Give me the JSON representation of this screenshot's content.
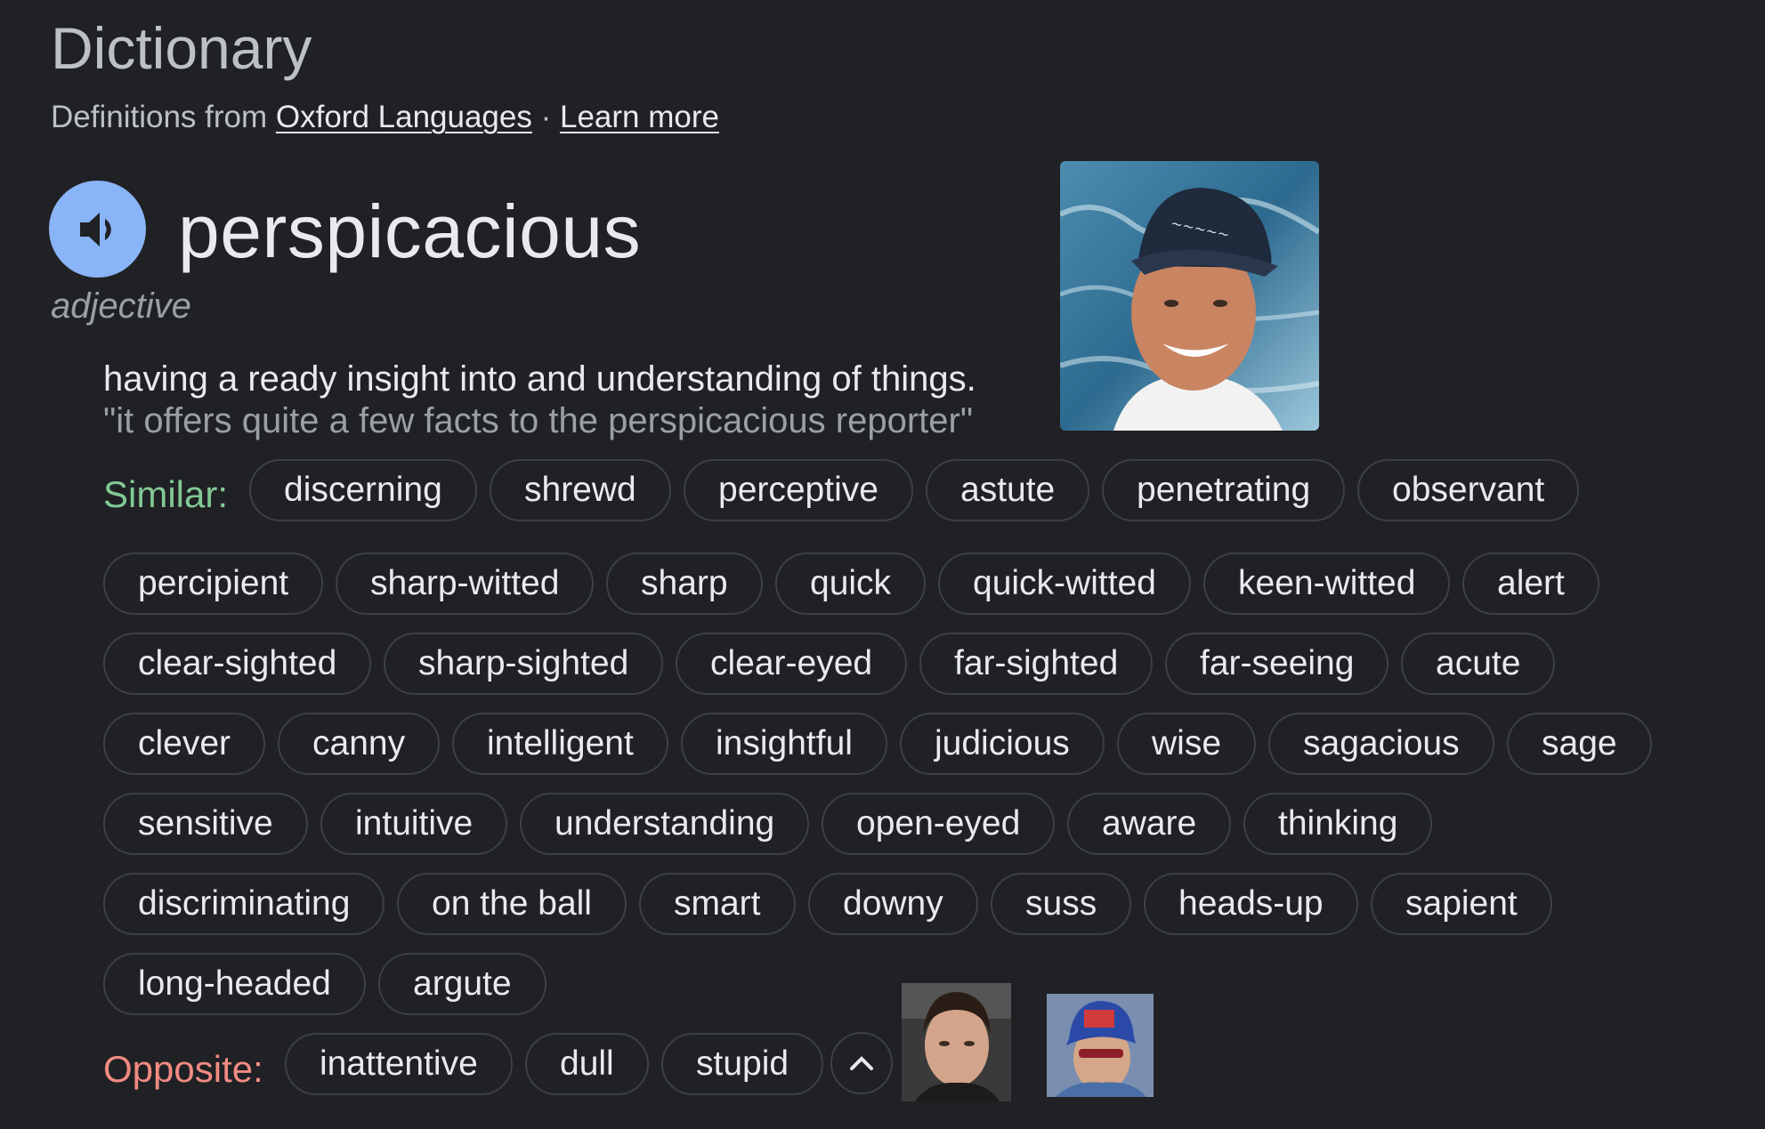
{
  "header": {
    "title": "Dictionary",
    "source_prefix": "Definitions from",
    "source_link": "Oxford Languages",
    "separator": "·",
    "learn_more": "Learn more"
  },
  "entry": {
    "word": "perspicacious",
    "part_of_speech": "adjective",
    "definition": "having a ready insight into and understanding of things.",
    "example": "\"it offers quite a few facts to the perspicacious reporter\"",
    "speaker_icon": "volume-speaker-icon"
  },
  "similar": {
    "label": "Similar:",
    "words": [
      "discerning",
      "shrewd",
      "perceptive",
      "astute",
      "penetrating",
      "observant",
      "percipient",
      "sharp-witted",
      "sharp",
      "quick",
      "quick-witted",
      "keen-witted",
      "alert",
      "clear-sighted",
      "sharp-sighted",
      "clear-eyed",
      "far-sighted",
      "far-seeing",
      "acute",
      "clever",
      "canny",
      "intelligent",
      "insightful",
      "judicious",
      "wise",
      "sagacious",
      "sage",
      "sensitive",
      "intuitive",
      "understanding",
      "open-eyed",
      "aware",
      "thinking",
      "discriminating",
      "on the ball",
      "smart",
      "downy",
      "suss",
      "heads-up",
      "sapient",
      "long-headed",
      "argute"
    ]
  },
  "opposite": {
    "label": "Opposite:",
    "words": [
      "inattentive",
      "dull",
      "stupid"
    ]
  },
  "controls": {
    "collapse_icon": "chevron-up-icon"
  },
  "colors": {
    "background": "#202124",
    "speaker": "#8ab4f8",
    "similar_label": "#81c995",
    "opposite_label": "#f28b82",
    "chip_border": "#3c4043"
  }
}
